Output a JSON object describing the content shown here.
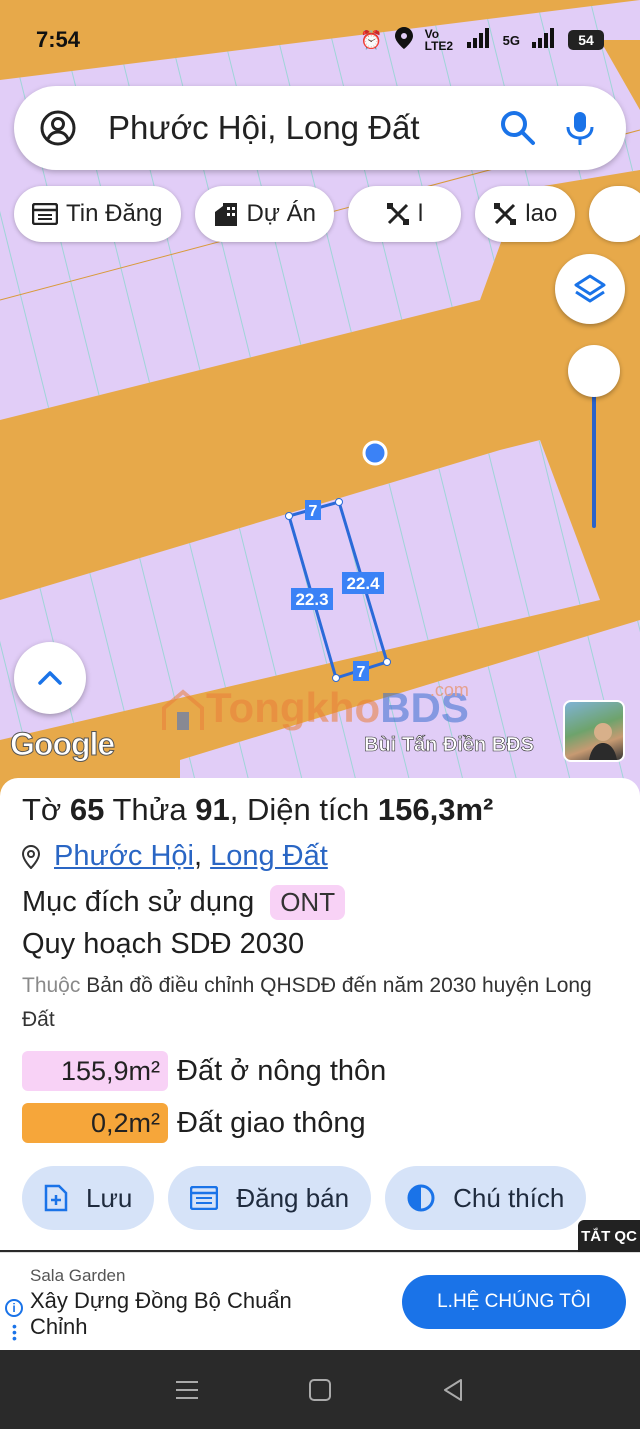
{
  "status_bar": {
    "time": "7:54",
    "network_label": "Vo LTE2",
    "signal_label": "5G",
    "battery_level": "54"
  },
  "search": {
    "query": "Phước Hội, Long Đất"
  },
  "chips": [
    {
      "label": "Tin Đăng",
      "icon": "listing-icon"
    },
    {
      "label": "Dự Án",
      "icon": "building-icon"
    },
    {
      "label": "l",
      "icon": "tools-icon"
    },
    {
      "label": "lao",
      "icon": "tools-icon"
    }
  ],
  "map": {
    "plot_edges": {
      "top": "7",
      "left": "22.3",
      "right": "22.4",
      "bottom": "7"
    },
    "google_label": "Google",
    "watermark": {
      "tong": "Tongkho",
      "bds": "BDS",
      "com": ".com"
    },
    "author": "Bùi Tấn Điền BĐS",
    "colors": {
      "road": "#e7a94a",
      "residential": "#e1cdf7"
    }
  },
  "parcel": {
    "sheet_label": "Tờ",
    "sheet_no": "65",
    "plot_label": "Thửa",
    "plot_no": "91",
    "area_label": "Diện tích",
    "area": "156,3m²",
    "ward": "Phước Hội",
    "district": "Long Đất",
    "purpose_label": "Mục đích sử dụng",
    "purpose_code": "ONT",
    "plan_title": "Quy hoạch SDĐ 2030",
    "belongs_label": "Thuộc",
    "plan_desc": "Bản đồ điều chỉnh QHSDĐ đến năm 2030 huyện Long Đất",
    "areas": [
      {
        "value": "155,9m²",
        "label": "Đất ở nông thôn",
        "color": "#f8d2f6"
      },
      {
        "value": "0,2m²",
        "label": "Đất giao thông",
        "color": "#f6a63a"
      }
    ]
  },
  "actions": {
    "save": "Lưu",
    "post": "Đăng bán",
    "legend": "Chú thích"
  },
  "ad": {
    "close_label": "TẮT QC",
    "brand": "Sala Garden",
    "headline": "Xây Dựng Đồng Bộ Chuẩn Chỉnh",
    "cta": "L.HỆ CHÚNG TÔI"
  }
}
